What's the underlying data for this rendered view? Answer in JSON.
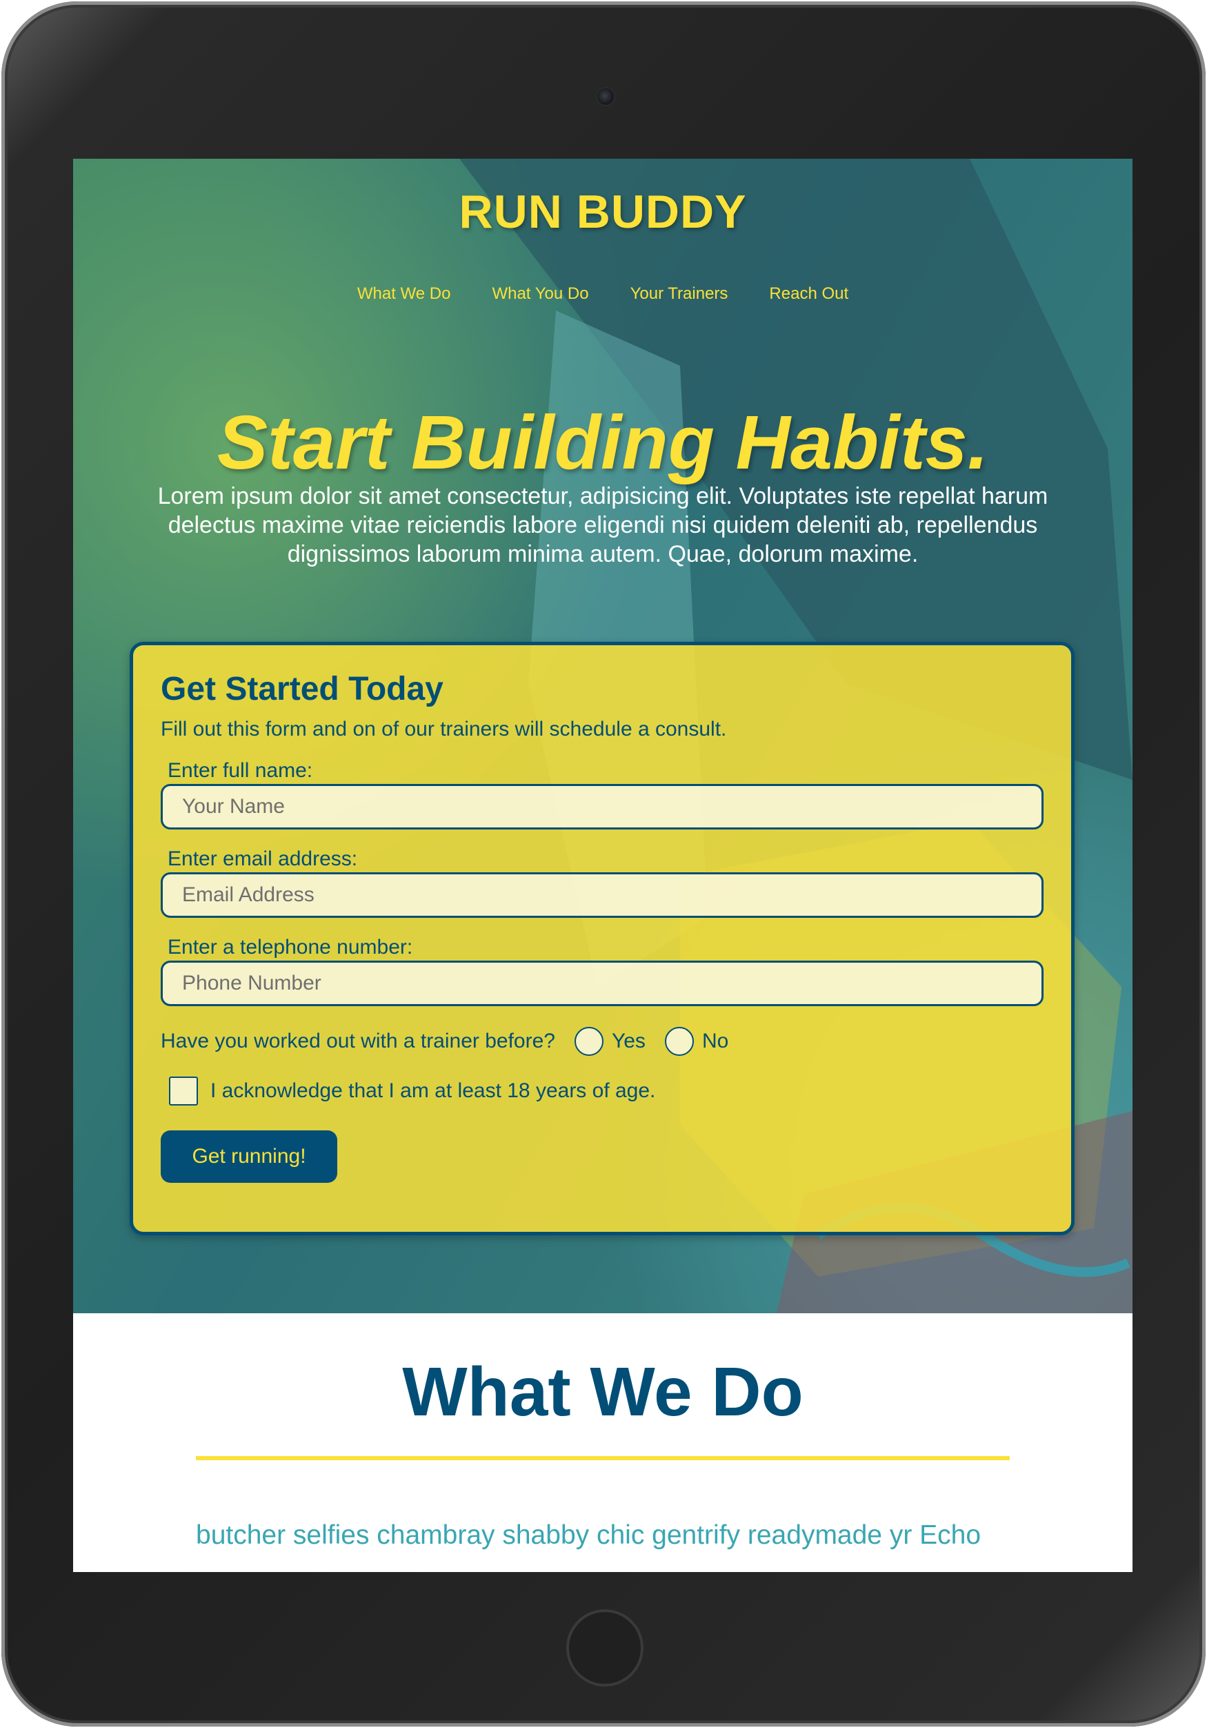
{
  "site": {
    "title": "RUN BUDDY"
  },
  "nav": {
    "items": [
      {
        "label": "What We Do"
      },
      {
        "label": "What You Do"
      },
      {
        "label": "Your Trainers"
      },
      {
        "label": "Reach Out"
      }
    ]
  },
  "hero": {
    "heading": "Start Building Habits.",
    "text": "Lorem ipsum dolor sit amet consectetur, adipisicing elit. Voluptates iste repellat harum delectus maxime vitae reiciendis labore eligendi nisi quidem deleniti ab, repellendus dignissimos laborum minima autem. Quae, dolorum maxime."
  },
  "form": {
    "title": "Get Started Today",
    "subtitle": "Fill out this form and on of our trainers will schedule a consult.",
    "name_label": "Enter full name:",
    "name_placeholder": "Your Name",
    "email_label": "Enter email address:",
    "email_placeholder": "Email Address",
    "phone_label": "Enter a telephone number:",
    "phone_placeholder": "Phone Number",
    "trainer_question": "Have you worked out with a trainer before?",
    "yes_label": "Yes",
    "no_label": "No",
    "age_ack": "I acknowledge that I am at least 18 years of age.",
    "submit_label": "Get running!"
  },
  "what_we_do": {
    "title": "What We Do",
    "text": "butcher selfies chambray shabby chic gentrify readymade yr Echo"
  },
  "colors": {
    "accent_yellow": "#fce138",
    "primary_blue": "#024e76",
    "teal_text": "#39a6b2"
  },
  "icons": {
    "camera": "camera-icon",
    "home_button": "home-button-icon"
  }
}
